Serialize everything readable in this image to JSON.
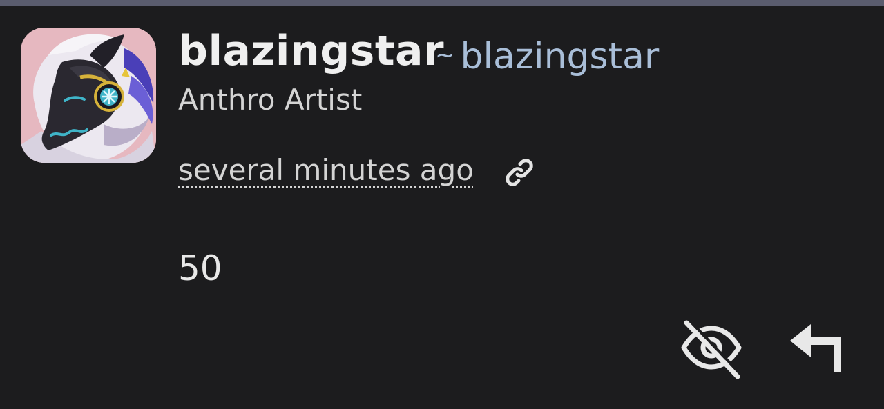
{
  "comment": {
    "author": {
      "display_name": "blazingstar",
      "handle_prefix": "~",
      "handle": "blazingstar",
      "title": "Anthro Artist"
    },
    "timestamp": "several minutes ago",
    "body": "50"
  },
  "icons": {
    "permalink": "link-icon",
    "hide": "eye-off-icon",
    "reply": "reply-arrow-icon"
  },
  "colors": {
    "background": "#1c1c1e",
    "handle": "#a9bed8",
    "text": "#e6e6e6"
  }
}
